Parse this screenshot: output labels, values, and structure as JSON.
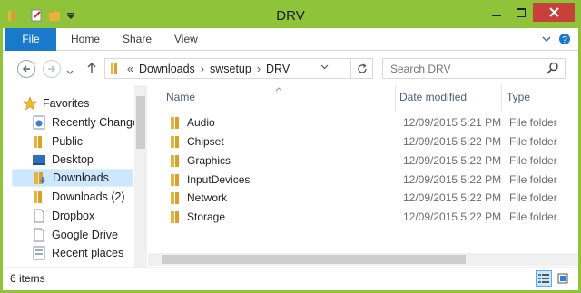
{
  "window": {
    "title": "DRV"
  },
  "ribbon": {
    "tabs": [
      "File",
      "Home",
      "Share",
      "View"
    ]
  },
  "address": {
    "overflow": "«",
    "crumbs": [
      "Downloads",
      "swsetup",
      "DRV"
    ]
  },
  "search": {
    "placeholder": "Search DRV"
  },
  "nav": {
    "items": [
      {
        "label": "Favorites",
        "icon": "star-icon"
      },
      {
        "label": "Recently Change",
        "icon": "recent-icon"
      },
      {
        "label": "Public",
        "icon": "folder-icon"
      },
      {
        "label": "Desktop",
        "icon": "desktop-icon"
      },
      {
        "label": "Downloads",
        "icon": "downloads-icon"
      },
      {
        "label": "Downloads (2)",
        "icon": "folder-icon"
      },
      {
        "label": "Dropbox",
        "icon": "file-icon"
      },
      {
        "label": "Google Drive",
        "icon": "file-icon"
      },
      {
        "label": "Recent places",
        "icon": "recent-places-icon"
      }
    ]
  },
  "columns": {
    "name": "Name",
    "date": "Date modified",
    "type": "Type"
  },
  "files": [
    {
      "name": "Audio",
      "date": "12/09/2015 5:21 PM",
      "type": "File folder"
    },
    {
      "name": "Chipset",
      "date": "12/09/2015 5:22 PM",
      "type": "File folder"
    },
    {
      "name": "Graphics",
      "date": "12/09/2015 5:22 PM",
      "type": "File folder"
    },
    {
      "name": "InputDevices",
      "date": "12/09/2015 5:22 PM",
      "type": "File folder"
    },
    {
      "name": "Network",
      "date": "12/09/2015 5:22 PM",
      "type": "File folder"
    },
    {
      "name": "Storage",
      "date": "12/09/2015 5:22 PM",
      "type": "File folder"
    }
  ],
  "status": {
    "count": "6 items"
  },
  "colors": {
    "accent": "#1979ca",
    "frame": "#8fc43a",
    "close": "#c7403a",
    "selection": "#cce8ff"
  }
}
